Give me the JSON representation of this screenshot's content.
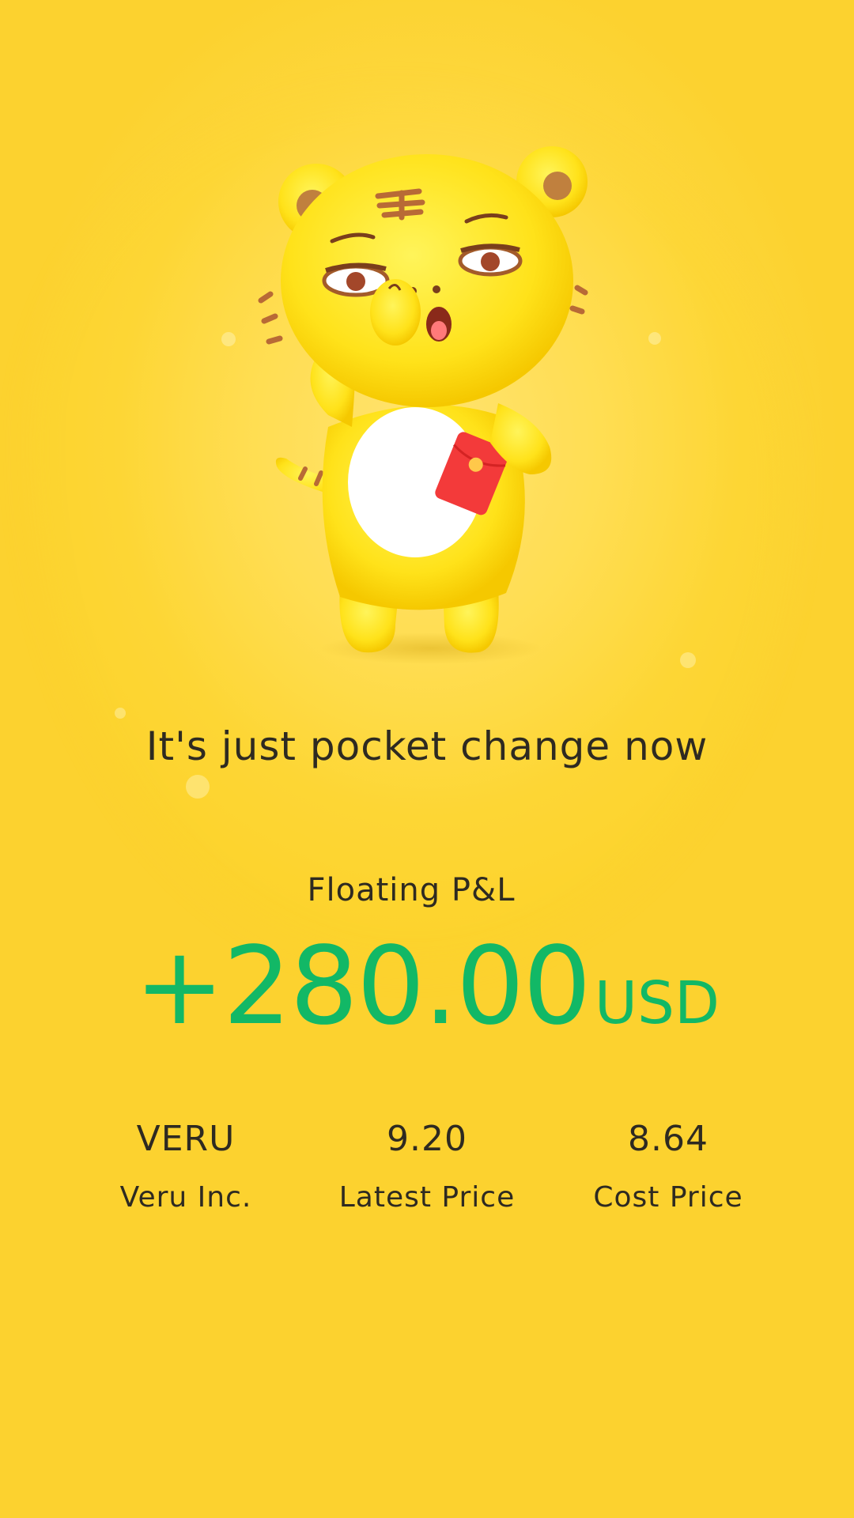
{
  "tagline": "It's just pocket change now",
  "pnl": {
    "label": "Floating P&L",
    "value": "+280.00",
    "currency": "USD"
  },
  "stats": [
    {
      "value": "VERU",
      "label": "Veru Inc."
    },
    {
      "value": "9.20",
      "label": "Latest Price"
    },
    {
      "value": "8.64",
      "label": "Cost Price"
    }
  ],
  "colors": {
    "background": "#fdd63a",
    "profit": "#12b866",
    "text": "#2e2a21"
  },
  "illustration": {
    "icon": "tiger-mascot-icon",
    "holding": "red-envelope-icon"
  }
}
